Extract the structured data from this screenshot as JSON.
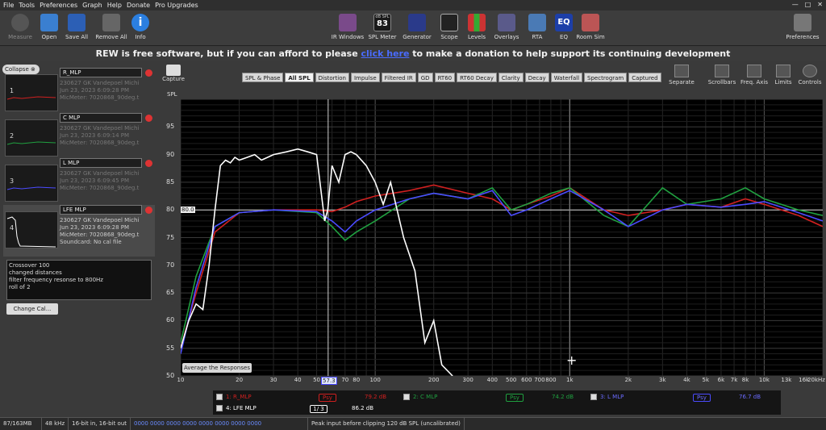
{
  "menu": [
    "File",
    "Tools",
    "Preferences",
    "Graph",
    "Help",
    "Donate",
    "Pro Upgrades"
  ],
  "toolbar_left": [
    "Measure",
    "Open",
    "Save All",
    "Remove All",
    "Info"
  ],
  "toolbar_center": [
    "IR Windows",
    "SPL Meter",
    "Generator",
    "Scope",
    "Levels",
    "Overlays",
    "RTA",
    "EQ",
    "Room Sim"
  ],
  "spl_meter": {
    "top": "dB SPL",
    "value": "83"
  },
  "preferences": "Preferences",
  "banner": {
    "pre": "REW is free software, but if you can afford to please ",
    "link": "click here",
    "post": " to make a donation to help support its continuing development"
  },
  "collapse": "Collapse",
  "measurements": [
    {
      "num": "1",
      "name": "R_MLP",
      "info": [
        "230627 GK Vandepoel Michi",
        "Jun 23, 2023 6:09:28 PM",
        "MicMeter: 7020868_90deg.t"
      ]
    },
    {
      "num": "2",
      "name": "C MLP",
      "info": [
        "230627 GK Vandepoel Michi",
        "Jun 23, 2023 6:09:14 PM",
        "MicMeter: 7020868_90deg.t"
      ]
    },
    {
      "num": "3",
      "name": "L MLP",
      "info": [
        "230627 GK Vandepoel Michi",
        "Jun 23, 2023 6:09:45 PM",
        "MicMeter: 7020868_90deg.t"
      ]
    },
    {
      "num": "4",
      "name": "LFE MLP",
      "info": [
        "230627 GK Vandepoel Michi",
        "Jun 23, 2023 6:09:28 PM",
        "MicMeter: 7020868_90deg.t",
        "Soundcard: No cal file"
      ]
    }
  ],
  "notes": [
    "Crossover 100",
    "changed distances",
    "filter frequency resonse to 800Hz",
    "roll of 2"
  ],
  "change_cal": "Change Cal...",
  "capture": "Capture",
  "tabs": [
    "SPL & Phase",
    "All SPL",
    "Distortion",
    "Impulse",
    "Filtered IR",
    "GD",
    "RT60",
    "RT60 Decay",
    "Clarity",
    "Decay",
    "Waterfall",
    "Spectrogram",
    "Captured"
  ],
  "active_tab": "All SPL",
  "right_tools": [
    "Separate",
    "Scrollbars",
    "Freq. Axis",
    "Limits",
    "Controls"
  ],
  "ylabel": "SPL",
  "yticks": [
    "95",
    "90",
    "85",
    "80",
    "75",
    "70",
    "65",
    "60",
    "55",
    "50"
  ],
  "xticks": [
    "10",
    "20",
    "30",
    "40",
    "50",
    "70",
    "80",
    "100",
    "200",
    "300",
    "400",
    "500",
    "600",
    "700",
    "800",
    "1k",
    "2k",
    "3k",
    "4k",
    "5k",
    "6k",
    "7k",
    "8k",
    "10k",
    "13k",
    "16k",
    "20kHz"
  ],
  "cursor_freq": "57.3",
  "ref_level": "80.0",
  "avg_button": "Average the Responses",
  "legend": [
    {
      "label": "1: R_MLP",
      "value": "79.2 dB",
      "color": "#d02020"
    },
    {
      "label": "2: C MLP",
      "value": "74.2 dB",
      "color": "#20a040"
    },
    {
      "label": "3: L MLP",
      "value": "76.7 dB",
      "color": "#4b4bff"
    },
    {
      "label": "4: LFE MLP",
      "value": "86.2 dB",
      "color": "#ffffff"
    }
  ],
  "psy": "Psy",
  "psy2": "1/ 3",
  "status": [
    "87/163MB",
    "48 kHz",
    "16-bit in, 16-bit out",
    "0000 0000  0000 0000  0000 0000  0000 0000",
    "Peak input before clipping 120 dB SPL (uncalibrated)"
  ],
  "chart_data": {
    "type": "line",
    "xscale": "log",
    "xlim": [
      10,
      20000
    ],
    "ylim": [
      50,
      100
    ],
    "series": [
      {
        "name": "1: R_MLP",
        "color": "#d02020",
        "x": [
          10,
          12,
          15,
          20,
          30,
          50,
          60,
          70,
          80,
          100,
          150,
          200,
          300,
          400,
          500,
          600,
          800,
          1000,
          1500,
          2000,
          3000,
          4000,
          6000,
          8000,
          10000,
          15000,
          20000
        ],
        "y": [
          55,
          65,
          76,
          79.5,
          80,
          80,
          79.7,
          80.5,
          81.5,
          82.5,
          83.5,
          84.5,
          83,
          82,
          80,
          81,
          82.5,
          84,
          80,
          79,
          80,
          81,
          80.5,
          82,
          81,
          79,
          77
        ]
      },
      {
        "name": "2: C MLP",
        "color": "#20a040",
        "x": [
          10,
          12,
          15,
          20,
          30,
          50,
          60,
          70,
          80,
          100,
          150,
          200,
          300,
          400,
          500,
          600,
          800,
          1000,
          1500,
          2000,
          3000,
          4000,
          6000,
          8000,
          10000,
          15000,
          20000
        ],
        "y": [
          56,
          68,
          77,
          79.5,
          80,
          79.5,
          77,
          74.5,
          76,
          78,
          82,
          83,
          82,
          84,
          80,
          81,
          83,
          84,
          79,
          77,
          84,
          81,
          82,
          84,
          82,
          80,
          79
        ]
      },
      {
        "name": "3: L MLP",
        "color": "#4b4bff",
        "x": [
          10,
          12,
          15,
          20,
          30,
          50,
          60,
          70,
          80,
          100,
          150,
          200,
          300,
          400,
          500,
          600,
          800,
          1000,
          1500,
          2000,
          3000,
          4000,
          6000,
          8000,
          10000,
          15000,
          20000
        ],
        "y": [
          54,
          66,
          77,
          79.5,
          80,
          79.7,
          78,
          76,
          78,
          80,
          82,
          83,
          82,
          83.5,
          79,
          80,
          82,
          83.5,
          80,
          77,
          80,
          81,
          80.5,
          81,
          81.5,
          79.5,
          78
        ]
      },
      {
        "name": "4: LFE MLP",
        "color": "#ffffff",
        "x": [
          10,
          11,
          12,
          13,
          14,
          15,
          16,
          17,
          18,
          19,
          20,
          22,
          24,
          26,
          28,
          30,
          35,
          40,
          45,
          50,
          55,
          57,
          60,
          65,
          70,
          75,
          80,
          90,
          100,
          110,
          120,
          140,
          160,
          180,
          200,
          220,
          250
        ],
        "y": [
          55,
          60,
          63,
          62,
          70,
          80,
          88,
          89,
          88.5,
          89.5,
          89,
          89.5,
          90,
          89,
          89.5,
          90,
          90.5,
          91,
          90.5,
          90,
          78,
          80,
          88,
          85,
          90,
          90.5,
          90,
          88,
          85,
          81,
          85,
          75,
          69,
          56,
          60,
          52,
          50
        ]
      }
    ]
  }
}
